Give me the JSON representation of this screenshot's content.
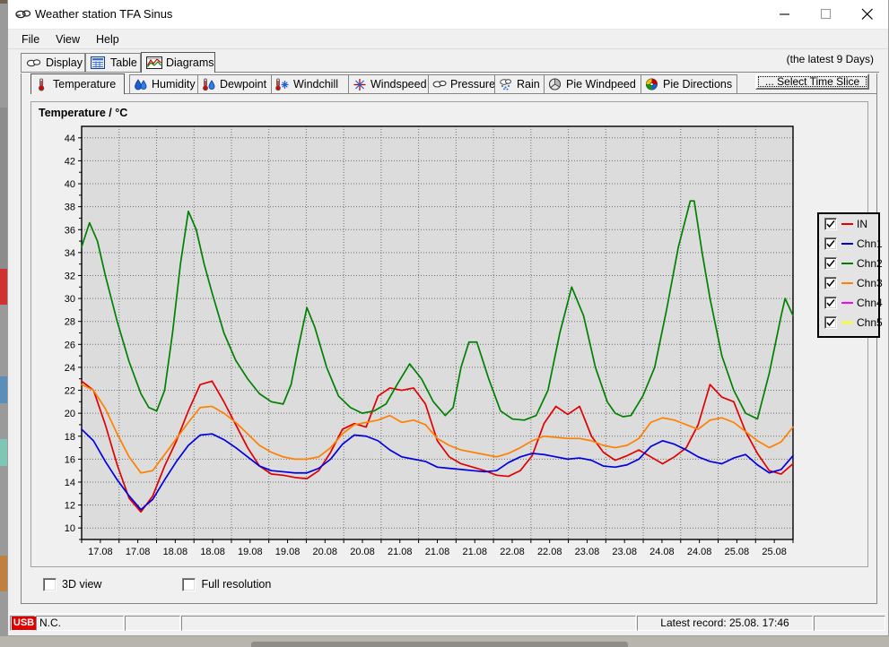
{
  "window": {
    "title": "Weather station TFA Sinus",
    "icon": "cloud-icon",
    "minimize_label": "Minimize",
    "maximize_label": "Maximize",
    "close_label": "Close"
  },
  "menu": {
    "items": [
      {
        "label": "File"
      },
      {
        "label": "View"
      },
      {
        "label": "Help"
      }
    ]
  },
  "outer_tabs": {
    "selected": 2,
    "items": [
      {
        "label": "Display",
        "icon": "cloud-icon"
      },
      {
        "label": "Table",
        "icon": "table-icon"
      },
      {
        "label": "Diagrams",
        "icon": "diagram-icon"
      }
    ]
  },
  "header": {
    "latest_days": "(the latest 9 Days)"
  },
  "inner_tabs": {
    "selected": 0,
    "items": [
      {
        "label": "Temperature",
        "icon": "thermometer-icon"
      },
      {
        "label": "Humidity",
        "icon": "droplets-icon"
      },
      {
        "label": "Dewpoint",
        "icon": "thermometer-droplet-icon"
      },
      {
        "label": "Windchill",
        "icon": "windchill-icon"
      },
      {
        "label": "Windspeed",
        "icon": "compass-star-icon"
      },
      {
        "label": "Pressure",
        "icon": "cloud-icon"
      },
      {
        "label": "Rain",
        "icon": "rain-icon"
      },
      {
        "label": "Pie Windpeed",
        "icon": "pie-gray-icon"
      },
      {
        "label": "Pie Directions",
        "icon": "pie-color-icon"
      }
    ]
  },
  "toolbar": {
    "select_time_slice_label": "... Select Time Slice"
  },
  "options": {
    "view_3d": {
      "label": "3D view",
      "checked": false
    },
    "full_resolution": {
      "label": "Full resolution",
      "checked": false
    }
  },
  "statusbar": {
    "usb_label": "USB",
    "connection": "N.C.",
    "blank1": "",
    "latest_record": "Latest record: 25.08. 17:46",
    "end": ""
  },
  "legend": {
    "items": [
      {
        "label": "IN",
        "color": "#e00000",
        "checked": true
      },
      {
        "label": "Chn1",
        "color": "#0000e0",
        "checked": true
      },
      {
        "label": "Chn2",
        "color": "#008000",
        "checked": true
      },
      {
        "label": "Chn3",
        "color": "#ff8000",
        "checked": true
      },
      {
        "label": "Chn4",
        "color": "#ff00ff",
        "checked": true
      },
      {
        "label": "Chn5",
        "color": "#ffff00",
        "checked": true
      }
    ]
  },
  "chart_data": {
    "type": "line",
    "title": "Temperature / °C",
    "xlabel": "",
    "ylabel": "Temperature / °C",
    "ylim": [
      9,
      45
    ],
    "yticks": [
      10,
      12,
      14,
      16,
      18,
      20,
      22,
      24,
      26,
      28,
      30,
      32,
      34,
      36,
      38,
      40,
      42,
      44
    ],
    "grid": true,
    "legend_position": "right-outside",
    "plot_bg": "#dcdcdc",
    "xtick_labels": [
      "17.08",
      "17.08",
      "18.08",
      "18.08",
      "19.08",
      "19.08",
      "20.08",
      "20.08",
      "21.08",
      "21.08",
      "21.08",
      "22.08",
      "22.08",
      "23.08",
      "23.08",
      "24.08",
      "24.08",
      "25.08",
      "25.08"
    ],
    "x_range_days": 9,
    "x_start": 16.75,
    "x_end": 25.75,
    "series": [
      {
        "name": "IN",
        "color": "#e00000",
        "x": [
          16.75,
          16.9,
          17.05,
          17.2,
          17.35,
          17.5,
          17.65,
          17.8,
          17.95,
          18.1,
          18.25,
          18.4,
          18.55,
          18.7,
          18.85,
          19.0,
          19.15,
          19.3,
          19.45,
          19.6,
          19.75,
          19.9,
          20.05,
          20.2,
          20.35,
          20.5,
          20.65,
          20.8,
          20.95,
          21.1,
          21.25,
          21.4,
          21.55,
          21.7,
          21.85,
          22.0,
          22.15,
          22.3,
          22.45,
          22.6,
          22.75,
          22.9,
          23.05,
          23.2,
          23.35,
          23.5,
          23.65,
          23.8,
          23.95,
          24.1,
          24.25,
          24.4,
          24.55,
          24.7,
          24.85,
          25.0,
          25.15,
          25.3,
          25.45,
          25.6,
          25.75
        ],
        "y": [
          22.8,
          22.0,
          19.0,
          15.5,
          12.6,
          11.4,
          12.8,
          15.4,
          17.6,
          20.2,
          22.5,
          22.8,
          21.0,
          19.0,
          17.0,
          15.4,
          14.7,
          14.6,
          14.4,
          14.3,
          15.0,
          16.6,
          18.6,
          19.1,
          18.8,
          21.5,
          22.2,
          22.0,
          22.2,
          20.8,
          17.6,
          16.2,
          15.6,
          15.3,
          15.0,
          14.6,
          14.5,
          15.0,
          16.3,
          19.1,
          20.6,
          19.9,
          20.6,
          18.0,
          16.6,
          15.9,
          16.3,
          16.8,
          16.2,
          15.6,
          16.2,
          17.0,
          19.0,
          22.5,
          21.4,
          21.0,
          18.4,
          16.5,
          15.0,
          14.7,
          15.6
        ]
      },
      {
        "name": "Chn1",
        "color": "#0000e0",
        "x": [
          16.75,
          16.9,
          17.05,
          17.2,
          17.35,
          17.5,
          17.65,
          17.8,
          17.95,
          18.1,
          18.25,
          18.4,
          18.55,
          18.7,
          18.85,
          19.0,
          19.15,
          19.3,
          19.45,
          19.6,
          19.75,
          19.9,
          20.05,
          20.2,
          20.35,
          20.5,
          20.65,
          20.8,
          20.95,
          21.1,
          21.25,
          21.4,
          21.55,
          21.7,
          21.85,
          22.0,
          22.15,
          22.3,
          22.45,
          22.6,
          22.75,
          22.9,
          23.05,
          23.2,
          23.35,
          23.5,
          23.65,
          23.8,
          23.95,
          24.1,
          24.25,
          24.4,
          24.55,
          24.7,
          24.85,
          25.0,
          25.15,
          25.3,
          25.45,
          25.6,
          25.75
        ],
        "y": [
          18.6,
          17.6,
          15.8,
          14.2,
          12.8,
          11.6,
          12.5,
          14.2,
          15.8,
          17.2,
          18.1,
          18.2,
          17.7,
          17.0,
          16.2,
          15.4,
          15.0,
          14.9,
          14.8,
          14.8,
          15.2,
          16.0,
          17.3,
          18.1,
          18.0,
          17.6,
          16.8,
          16.2,
          16.0,
          15.8,
          15.3,
          15.2,
          15.1,
          15.0,
          14.9,
          15.0,
          15.7,
          16.2,
          16.5,
          16.4,
          16.2,
          16.0,
          16.1,
          15.9,
          15.4,
          15.3,
          15.5,
          16.0,
          17.1,
          17.6,
          17.3,
          16.8,
          16.2,
          15.8,
          15.6,
          16.1,
          16.4,
          15.5,
          14.8,
          15.1,
          16.3
        ]
      },
      {
        "name": "Chn2",
        "color": "#008000",
        "x": [
          16.75,
          16.85,
          16.95,
          17.05,
          17.2,
          17.35,
          17.5,
          17.6,
          17.7,
          17.8,
          17.9,
          18.0,
          18.1,
          18.2,
          18.3,
          18.4,
          18.55,
          18.7,
          18.85,
          19.0,
          19.15,
          19.3,
          19.4,
          19.5,
          19.6,
          19.7,
          19.85,
          20.0,
          20.15,
          20.3,
          20.45,
          20.6,
          20.75,
          20.9,
          21.05,
          21.2,
          21.35,
          21.45,
          21.55,
          21.65,
          21.75,
          21.9,
          22.05,
          22.2,
          22.35,
          22.5,
          22.65,
          22.8,
          22.95,
          23.1,
          23.25,
          23.4,
          23.5,
          23.6,
          23.7,
          23.85,
          24.0,
          24.15,
          24.3,
          24.45,
          24.5,
          24.6,
          24.7,
          24.85,
          25.0,
          25.15,
          25.3,
          25.45,
          25.6,
          25.65,
          25.75
        ],
        "y": [
          34.5,
          36.6,
          35.0,
          32.0,
          28.0,
          24.5,
          21.7,
          20.5,
          20.2,
          22.0,
          27.0,
          33.0,
          37.6,
          36.0,
          33.0,
          30.5,
          27.0,
          24.6,
          23.0,
          21.7,
          21.0,
          20.8,
          22.5,
          26.0,
          29.2,
          27.5,
          24.0,
          21.5,
          20.5,
          20.0,
          20.2,
          20.8,
          22.6,
          24.3,
          23.0,
          21.0,
          19.8,
          20.5,
          24.0,
          26.2,
          26.2,
          23.0,
          20.2,
          19.5,
          19.4,
          19.8,
          22.0,
          27.0,
          31.0,
          28.5,
          24.0,
          21.0,
          20.0,
          19.7,
          19.8,
          21.5,
          24.0,
          29.0,
          34.5,
          38.5,
          38.5,
          34.0,
          30.0,
          25.0,
          22.0,
          20.0,
          19.5,
          23.5,
          28.5,
          30.0,
          28.5
        ]
      },
      {
        "name": "Chn3",
        "color": "#ff8000",
        "x": [
          16.75,
          16.9,
          17.05,
          17.2,
          17.35,
          17.5,
          17.65,
          17.8,
          17.95,
          18.1,
          18.25,
          18.4,
          18.55,
          18.7,
          18.85,
          19.0,
          19.15,
          19.3,
          19.45,
          19.6,
          19.75,
          19.9,
          20.05,
          20.2,
          20.35,
          20.5,
          20.65,
          20.8,
          20.95,
          21.1,
          21.25,
          21.4,
          21.55,
          21.7,
          21.85,
          22.0,
          22.15,
          22.3,
          22.45,
          22.6,
          22.75,
          22.9,
          23.05,
          23.2,
          23.35,
          23.5,
          23.65,
          23.8,
          23.95,
          24.1,
          24.25,
          24.4,
          24.55,
          24.7,
          24.85,
          25.0,
          25.15,
          25.3,
          25.45,
          25.6,
          25.75
        ],
        "y": [
          22.5,
          22.0,
          20.4,
          18.2,
          16.2,
          14.8,
          15.0,
          16.4,
          17.8,
          19.2,
          20.5,
          20.6,
          20.0,
          19.2,
          18.2,
          17.2,
          16.6,
          16.2,
          16.0,
          16.0,
          16.2,
          17.0,
          18.2,
          19.0,
          19.2,
          19.4,
          19.8,
          19.2,
          19.4,
          19.0,
          17.8,
          17.2,
          16.8,
          16.6,
          16.4,
          16.2,
          16.5,
          17.0,
          17.6,
          18.0,
          17.9,
          17.8,
          17.8,
          17.6,
          17.2,
          17.0,
          17.2,
          17.8,
          19.2,
          19.6,
          19.4,
          19.0,
          18.6,
          19.4,
          19.6,
          19.2,
          18.4,
          17.6,
          17.0,
          17.5,
          18.8
        ]
      }
    ]
  }
}
